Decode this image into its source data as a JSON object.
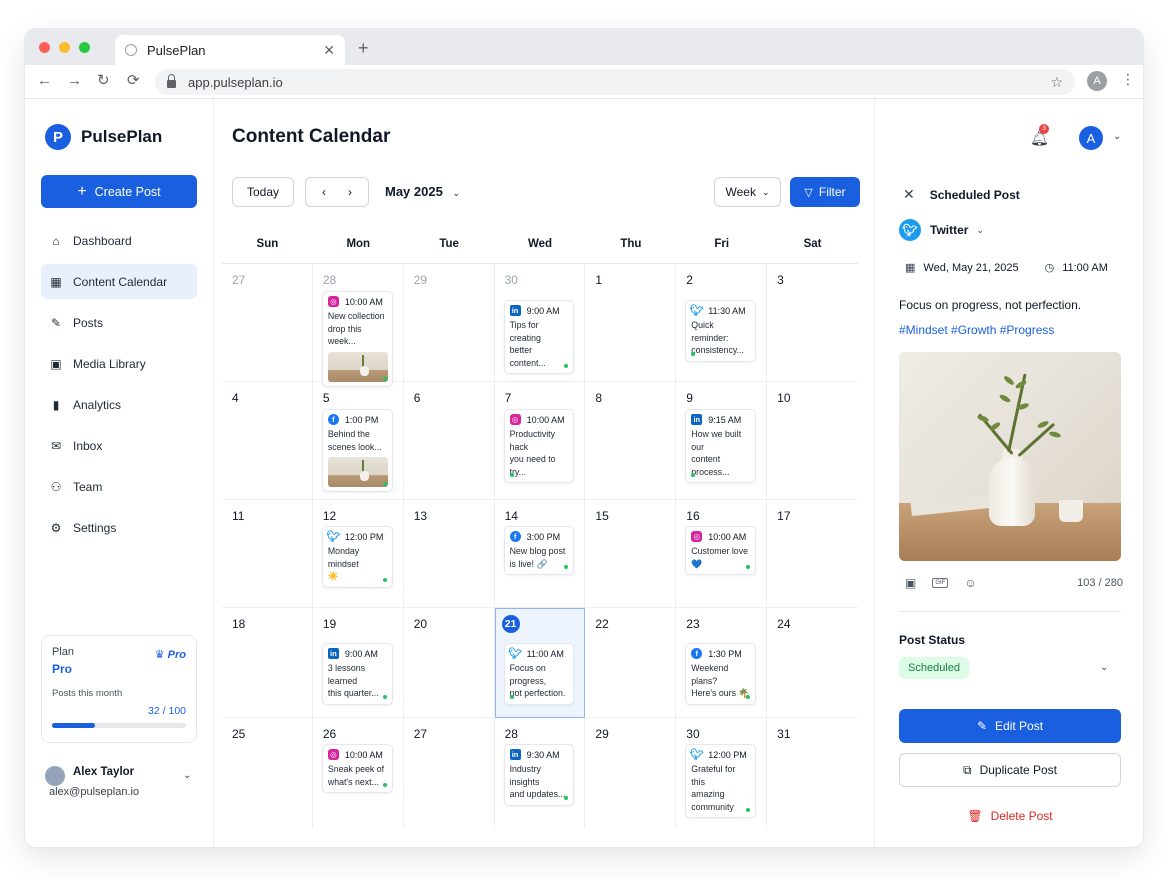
{
  "browser": {
    "tab_title": "PulsePlan",
    "url": "app.pulseplan.io",
    "profile_initial": "A"
  },
  "sidebar": {
    "brand": "PulsePlan",
    "logo_letter": "P",
    "create_label": "Create Post",
    "items": [
      {
        "label": "Dashboard",
        "icon": "home-icon"
      },
      {
        "label": "Content Calendar",
        "icon": "calendar-icon",
        "active": true
      },
      {
        "label": "Posts",
        "icon": "edit-icon"
      },
      {
        "label": "Media Library",
        "icon": "image-icon"
      },
      {
        "label": "Analytics",
        "icon": "bar-chart-icon"
      },
      {
        "label": "Inbox",
        "icon": "inbox-icon"
      },
      {
        "label": "Team",
        "icon": "users-icon"
      },
      {
        "label": "Settings",
        "icon": "gear-icon"
      }
    ],
    "plan": {
      "label": "Plan",
      "name": "Pro",
      "badge": "Pro",
      "usage_label": "Posts this month",
      "usage_left": "",
      "usage_count": "32 / 100",
      "usage_fraction": 0.32
    },
    "user": {
      "name": "Alex Taylor",
      "email": "alex@pulseplan.io"
    }
  },
  "main": {
    "title": "Content Calendar",
    "today_label": "Today",
    "month_label": "May 2025",
    "view_label": "Week",
    "filter_label": "Filter",
    "weekdays": [
      "Sun",
      "Mon",
      "Tue",
      "Wed",
      "Thu",
      "Fri",
      "Sat"
    ],
    "weeks": [
      [
        {
          "day": "27",
          "muted": true
        },
        {
          "day": "28",
          "muted": true,
          "post": {
            "net": "ig",
            "time": "10:00 AM",
            "text": "New collection\ndrop this week...",
            "thumb": true
          }
        },
        {
          "day": "29",
          "muted": true
        },
        {
          "day": "30",
          "muted": true,
          "post": {
            "net": "li",
            "time": "9:00 AM",
            "text": "Tips for creating\nbetter content..."
          }
        },
        {
          "day": "1"
        },
        {
          "day": "2",
          "post": {
            "net": "tw",
            "time": "11:30 AM",
            "text": "Quick reminder:\nconsistency...",
            "dotLeft": true
          }
        },
        {
          "day": "3"
        }
      ],
      [
        {
          "day": "4"
        },
        {
          "day": "5",
          "post": {
            "net": "fb",
            "time": "1:00 PM",
            "text": "Behind the\nscenes look...",
            "thumb": true
          }
        },
        {
          "day": "6"
        },
        {
          "day": "7",
          "post": {
            "net": "ig",
            "time": "10:00 AM",
            "text": "Productivity hack\nyou need to try...",
            "dotLeft": true
          }
        },
        {
          "day": "8"
        },
        {
          "day": "9",
          "post": {
            "net": "li",
            "time": "9:15 AM",
            "text": "How we built our\ncontent process...",
            "dotLeft": true
          }
        },
        {
          "day": "10"
        }
      ],
      [
        {
          "day": "11"
        },
        {
          "day": "12",
          "post": {
            "net": "tw",
            "time": "12:00 PM",
            "text": "Monday mindset\n☀️"
          }
        },
        {
          "day": "13"
        },
        {
          "day": "14",
          "post": {
            "net": "fb",
            "time": "3:00 PM",
            "text": "New blog post\nis live! 🔗"
          }
        },
        {
          "day": "15"
        },
        {
          "day": "16",
          "post": {
            "net": "ig",
            "time": "10:00 AM",
            "text": "Customer love\n💙"
          }
        },
        {
          "day": "17"
        }
      ],
      [
        {
          "day": "18"
        },
        {
          "day": "19",
          "post": {
            "net": "li",
            "time": "9:00 AM",
            "text": "3 lessons learned\nthis quarter..."
          }
        },
        {
          "day": "20"
        },
        {
          "day": "21",
          "today": true,
          "post": {
            "net": "tw",
            "time": "11:00 AM",
            "text": "Focus on progress,\nnot perfection.",
            "dotLeft": true
          }
        },
        {
          "day": "22"
        },
        {
          "day": "23",
          "post": {
            "net": "fb",
            "time": "1:30 PM",
            "text": "Weekend plans?\nHere's ours 🌴"
          }
        },
        {
          "day": "24"
        }
      ],
      [
        {
          "day": "25"
        },
        {
          "day": "26",
          "post": {
            "net": "ig",
            "time": "10:00 AM",
            "text": "Sneak peek of\nwhat's next..."
          }
        },
        {
          "day": "27"
        },
        {
          "day": "28",
          "post": {
            "net": "li",
            "time": "9:30 AM",
            "text": "Industry insights\nand updates..."
          }
        },
        {
          "day": "29"
        },
        {
          "day": "30",
          "post": {
            "net": "tw",
            "time": "12:00 PM",
            "text": "Grateful for this\namazing community"
          }
        },
        {
          "day": "31"
        }
      ]
    ]
  },
  "panel": {
    "notification_count": "3",
    "avatar_initial": "A",
    "header": "Scheduled Post",
    "network": "Twitter",
    "date": "Wed, May 21, 2025",
    "time": "11:00 AM",
    "caption": "Focus on progress, not perfection.",
    "hashtags": "#Mindset #Growth #Progress",
    "char_count": "103 / 280",
    "gif_label": "GIF",
    "status_label": "Post Status",
    "status_value": "Scheduled",
    "edit_label": "Edit Post",
    "duplicate_label": "Duplicate Post",
    "delete_label": "Delete Post"
  },
  "colors": {
    "accent": "#1a5fe0",
    "status_green": "#22c55e",
    "danger": "#dc2626"
  }
}
